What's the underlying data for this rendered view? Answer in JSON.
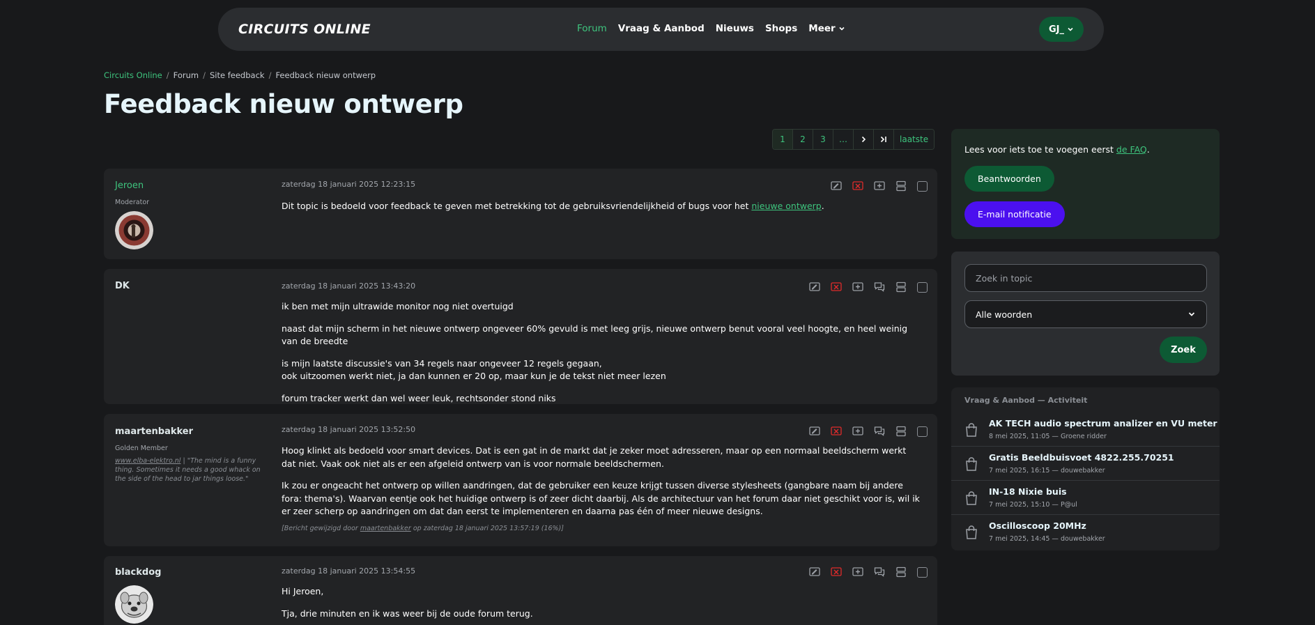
{
  "nav": {
    "brand": "CIRCUITS ONLINE",
    "links": [
      {
        "label": "Forum",
        "active": true
      },
      {
        "label": "Vraag & Aanbod",
        "active": false
      },
      {
        "label": "Nieuws",
        "active": false
      },
      {
        "label": "Shops",
        "active": false
      },
      {
        "label": "Meer",
        "active": false,
        "dropdown": true
      }
    ],
    "user": "GJ_"
  },
  "breadcrumb": [
    "Circuits Online",
    "Forum",
    "Site feedback",
    "Feedback nieuw ontwerp"
  ],
  "page_title": "Feedback nieuw ontwerp",
  "pagination": {
    "pages": [
      "1",
      "2",
      "3",
      "…"
    ],
    "current": "1",
    "last_label": "laatste",
    "next_icon": "chevron-right-icon",
    "end_icon": "chevron-end-icon"
  },
  "posts": [
    {
      "author": "Jeroen",
      "role": "Moderator",
      "date": "zaterdag 18 januari 2025 12:23:15",
      "body_before": "Dit topic is bedoeld voor feedback te geven met betrekking tot de gebruiksvriendelijkheid of bugs voor het ",
      "body_link": "nieuwe ontwerp",
      "body_after": "."
    },
    {
      "author": "DK",
      "date": "zaterdag 18 januari 2025 13:43:20",
      "paragraphs": [
        "ik ben met mijn ultrawide monitor nog niet overtuigd",
        "naast dat mijn scherm in het nieuwe ontwerp ongeveer 60% gevuld is met leeg grijs, nieuwe ontwerp benut vooral veel hoogte, en heel weinig van de breedte",
        "is mijn laatste discussie's van 34 regels naar ongeveer 12 regels gegaan,",
        "ook uitzoomen werkt niet, ja dan kunnen er 20 op, maar kun je de tekst niet meer lezen",
        "forum tracker werkt dan wel weer leuk, rechtsonder stond niks"
      ]
    },
    {
      "author": "maartenbakker",
      "role": "Golden Member",
      "signature_link": "www.elba-elektro.nl",
      "signature_text": " | \"The mind is a funny thing. Sometimes it needs a good whack on the side of the head to jar things loose.\"",
      "date": "zaterdag 18 januari 2025 13:52:50",
      "paragraphs": [
        "Hoog klinkt als bedoeld voor smart devices. Dat is een gat in de markt dat je zeker moet adresseren, maar op een normaal beeldscherm werkt dat niet. Vaak ook niet als er een afgeleid ontwerp van is voor normale beeldschermen.",
        "Ik zou er ongeacht het ontwerp op willen aandringen, dat de gebruiker een keuze krijgt tussen diverse stylesheets (gangbare naam bij andere fora: thema's). Waarvan eentje ook het huidige ontwerp is of zeer dicht daarbij. Als de architectuur van het forum daar niet geschikt voor is, wil ik er zeer scherp op aandringen om dat dan eerst te implementeren en daarna pas één of meer nieuwe designs."
      ],
      "edit_before": "[Bericht gewijzigd door ",
      "edit_user": "maartenbakker",
      "edit_after": " op zaterdag 18 januari 2025 13:57:19 (16%)]"
    },
    {
      "author": "blackdog",
      "date": "zaterdag 18 januari 2025 13:54:55",
      "paragraphs": [
        "Hi Jeroen,",
        "Tja, drie minuten en ik was weer bij de oude forum terug."
      ]
    }
  ],
  "sidebar": {
    "faq_before": "Lees voor iets toe te voegen eerst ",
    "faq_link": "de FAQ",
    "faq_after": ".",
    "reply_button": "Beantwoorden",
    "email_button": "E-mail notificatie",
    "search_placeholder": "Zoek in topic",
    "search_mode": "Alle woorden",
    "search_button": "Zoek",
    "activity_title": "Vraag & Aanbod — Activiteit",
    "activity": [
      {
        "title": "AK TECH audio spectrum analizer en VU meter",
        "meta": "8 mei 2025, 11:05 — Groene ridder"
      },
      {
        "title": "Gratis Beeldbuisvoet 4822.255.70251",
        "meta": "7 mei 2025, 16:15 — douwebakker"
      },
      {
        "title": "IN-18 Nixie buis",
        "meta": "7 mei 2025, 15:10 — P@ul"
      },
      {
        "title": "Oscilloscoop 20MHz",
        "meta": "7 mei 2025, 14:45 — douwebakker"
      }
    ]
  },
  "colors": {
    "accent": "#3ec57e",
    "button_green": "#0d5a34",
    "button_purple": "#4b10ef",
    "delete_red": "#e02b2b",
    "background": "#18191b",
    "card": "#222325"
  }
}
